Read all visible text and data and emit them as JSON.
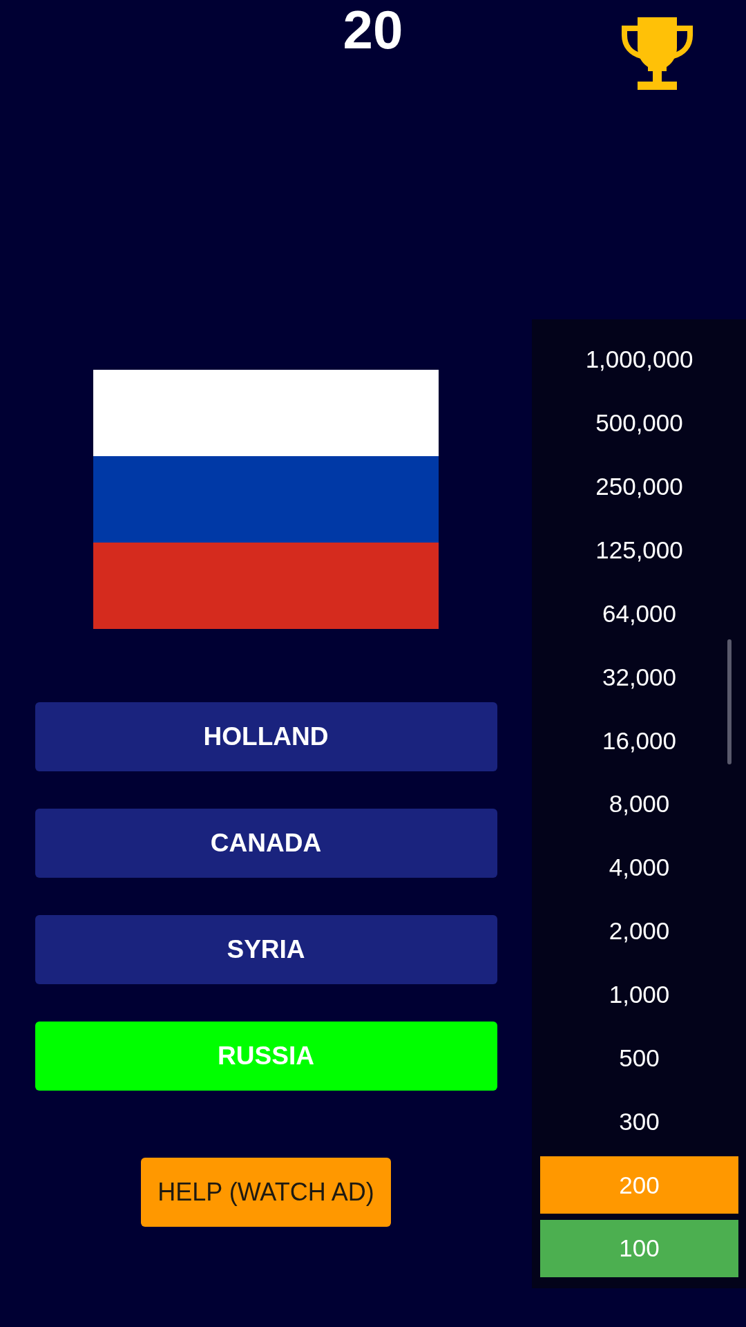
{
  "score": "20",
  "answers": [
    {
      "label": "HOLLAND",
      "correct": false
    },
    {
      "label": "CANADA",
      "correct": false
    },
    {
      "label": "SYRIA",
      "correct": false
    },
    {
      "label": "RUSSIA",
      "correct": true
    }
  ],
  "help_button": {
    "label": "HELP (WATCH AD)"
  },
  "prize_ladder": [
    {
      "amount": "1,000,000",
      "current": false,
      "won": false
    },
    {
      "amount": "500,000",
      "current": false,
      "won": false
    },
    {
      "amount": "250,000",
      "current": false,
      "won": false
    },
    {
      "amount": "125,000",
      "current": false,
      "won": false
    },
    {
      "amount": "64,000",
      "current": false,
      "won": false
    },
    {
      "amount": "32,000",
      "current": false,
      "won": false
    },
    {
      "amount": "16,000",
      "current": false,
      "won": false
    },
    {
      "amount": "8,000",
      "current": false,
      "won": false
    },
    {
      "amount": "4,000",
      "current": false,
      "won": false
    },
    {
      "amount": "2,000",
      "current": false,
      "won": false
    },
    {
      "amount": "1,000",
      "current": false,
      "won": false
    },
    {
      "amount": "500",
      "current": false,
      "won": false
    },
    {
      "amount": "300",
      "current": false,
      "won": false
    },
    {
      "amount": "200",
      "current": true,
      "won": false
    },
    {
      "amount": "100",
      "current": false,
      "won": true
    }
  ]
}
